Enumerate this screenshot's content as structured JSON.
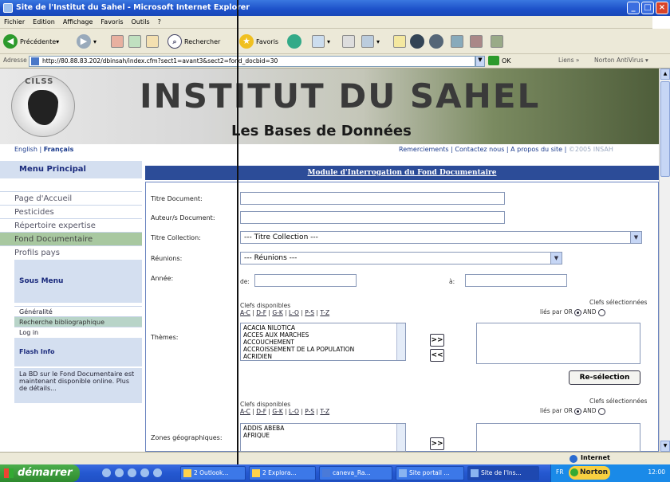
{
  "window": {
    "title": "Site de l'Institut du Sahel - Microsoft Internet Explorer"
  },
  "menubar": [
    "Fichier",
    "Edition",
    "Affichage",
    "Favoris",
    "Outils",
    "?"
  ],
  "toolbar": {
    "back": "Précédente",
    "search": "Rechercher",
    "favorites": "Favoris"
  },
  "address": {
    "label": "Adresse",
    "url": "http://80.88.83.202/dbinsah/index.cfm?sect1=avant3&sect2=fond_docbid=30",
    "go": "OK",
    "links": "Liens",
    "norton": "Norton AntiVirus"
  },
  "header": {
    "title": "INSTITUT DU SAHEL",
    "subtitle": "Les Bases de Données",
    "logo_text": "CILSS"
  },
  "langs": {
    "english": "English",
    "sep": "|",
    "francais": "Français"
  },
  "toplinks": {
    "remerciements": "Remerciements",
    "contact": "Contactez nous",
    "apropos": "A propos du site",
    "copyright": "©2005 INSAH"
  },
  "leftmenu": {
    "title": "Menu Principal",
    "items": [
      "Page d'Accueil",
      "Pesticides",
      "Répertoire expertise",
      "Fond Documentaire",
      "Profils pays"
    ],
    "selected_index": 3,
    "sous_menu_title": "Sous Menu",
    "sub_items": [
      "Généralité",
      "Recherche bibliographique",
      "Log in"
    ],
    "flash_title": "Flash Info",
    "flash_text": "La BD sur le Fond Documentaire est maintenant disponible online. Plus de détails..."
  },
  "form": {
    "heading": "Module d'Interrogation du Fond Documentaire",
    "labels": {
      "titre_doc": "Titre Document:",
      "auteurs": "Auteur/s Document:",
      "titre_collection": "Titre Collection:",
      "reunions": "Réunions:",
      "annee": "Année:",
      "themes": "Thèmes:",
      "zones": "Zones géographiques:"
    },
    "titre_collection_value": "--- Titre Collection ---",
    "reunions_value": "--- Réunions ---",
    "annee_de": "de:",
    "annee_a": "à:",
    "clefs_dispo": "Clefs disponibles",
    "clefs_sel": "Clefs sélectionnées",
    "key_ranges": [
      "A-C",
      "D-F",
      "G-K",
      "L-O",
      "P-S",
      "T-Z"
    ],
    "lies_par": "liés par OR",
    "and": "AND",
    "themes_list": [
      "ACACIA NILOTICA",
      "ACCES AUX MARCHES",
      "ACCOUCHEMENT",
      "ACCROISSEMENT DE LA POPULATION",
      "ACRIDIEN"
    ],
    "zones_list": [
      "ADDIS ABEBA",
      "AFRIQUE"
    ],
    "add_btn": ">>",
    "remove_btn": "<<",
    "reselect_btn": "Re-sélection"
  },
  "statusbar": {
    "zone": "Internet"
  },
  "taskbar": {
    "start": "démarrer",
    "tasks": [
      "2 Outlook...",
      "2 Explora...",
      "caneva_Ra...",
      "Site portail ...",
      "Site de l'Ins..."
    ],
    "lang": "FR",
    "norton": "Norton",
    "clock": "12:00"
  }
}
